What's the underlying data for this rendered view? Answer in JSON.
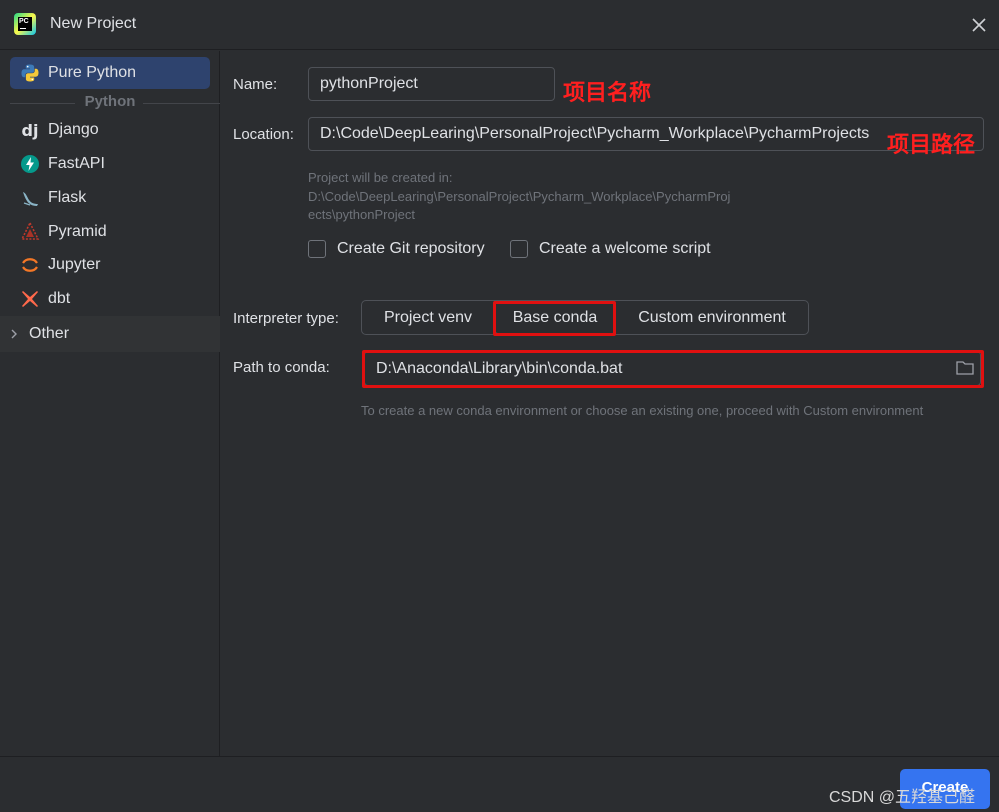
{
  "window": {
    "title": "New Project"
  },
  "sidebar": {
    "selected": {
      "label": "Pure Python",
      "icon": "python-icon"
    },
    "group_header": "Python",
    "items": [
      {
        "label": "Django",
        "icon": "django-icon"
      },
      {
        "label": "FastAPI",
        "icon": "fastapi-icon"
      },
      {
        "label": "Flask",
        "icon": "flask-icon"
      },
      {
        "label": "Pyramid",
        "icon": "pyramid-icon"
      },
      {
        "label": "Jupyter",
        "icon": "jupyter-icon"
      },
      {
        "label": "dbt",
        "icon": "dbt-icon"
      }
    ],
    "other": {
      "label": "Other",
      "icon": "chevron-right-icon"
    }
  },
  "form": {
    "name_label": "Name:",
    "name_value": "pythonProject",
    "name_annotation": "项目名称",
    "location_label": "Location:",
    "location_value": "D:\\Code\\DeepLearing\\PersonalProject\\Pycharm_Workplace\\PycharmProjects",
    "location_annotation": "项目路径",
    "created_in_line1": "Project will be created in:",
    "created_in_line2": "D:\\Code\\DeepLearing\\PersonalProject\\Pycharm_Workplace\\PycharmProj",
    "created_in_line3": "ects\\pythonProject",
    "git_checkbox": {
      "label": "Create Git repository",
      "checked": false
    },
    "welcome_checkbox": {
      "label": "Create a welcome script",
      "checked": false
    },
    "interpreter_label": "Interpreter type:",
    "interpreter_options": [
      "Project venv",
      "Base conda",
      "Custom environment"
    ],
    "interpreter_selected": "Base conda",
    "conda_label": "Path to conda:",
    "conda_value": "D:\\Anaconda\\Library\\bin\\conda.bat",
    "conda_hint": "To create a new conda environment or choose an existing one, proceed with Custom environment"
  },
  "footer": {
    "create_label": "Create",
    "watermark": "CSDN @五羟基己醛"
  },
  "colors": {
    "background": "#2b2d30",
    "selection": "#2e436e",
    "accent": "#3574f0",
    "annotation_red": "#ff1f1f"
  }
}
